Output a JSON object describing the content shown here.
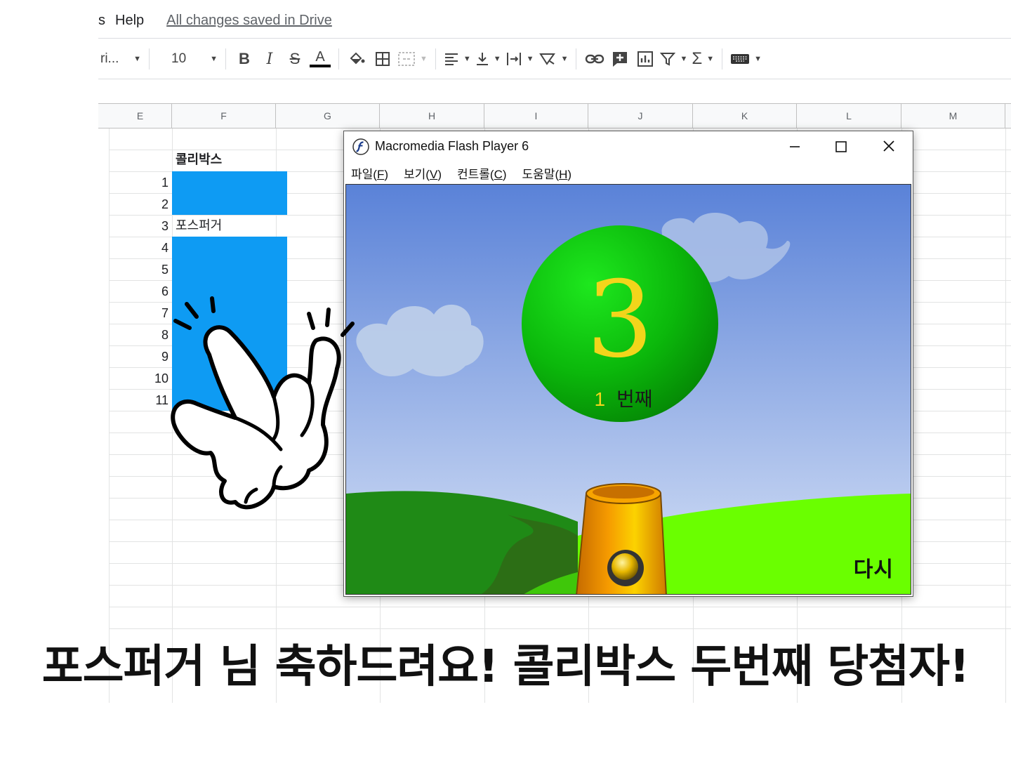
{
  "menubar": {
    "items": [
      "s",
      "Help"
    ],
    "saved_status": "All changes saved in Drive"
  },
  "toolbar": {
    "font_name": "ri...",
    "font_size": "10",
    "bold": "B",
    "italic": "I",
    "strike": "S",
    "text_color": "A",
    "sum": "Σ"
  },
  "sheet": {
    "columns": [
      "E",
      "F",
      "G",
      "H",
      "I",
      "J",
      "K",
      "L",
      "M"
    ],
    "header_cell": "콜리박스",
    "rows": [
      "1",
      "2",
      "3",
      "4",
      "5",
      "6",
      "7",
      "8",
      "9",
      "10",
      "11"
    ],
    "winner_cell": "포스퍼거",
    "highlight_color": "#0e9bf3"
  },
  "flash_window": {
    "title": "Macromedia Flash Player 6",
    "menu": [
      {
        "label": "파일(",
        "key": "F",
        "end": ")"
      },
      {
        "label": "보기(",
        "key": "V",
        "end": ")"
      },
      {
        "label": "컨트롤(",
        "key": "C",
        "end": ")"
      },
      {
        "label": "도움말(",
        "key": "H",
        "end": ")"
      }
    ],
    "ball_number": "3",
    "ball_count": "1",
    "ball_suffix": "번째",
    "replay_label": "다시"
  },
  "caption": "포스퍼거 님 축하드려요! 콜리박스 두번째 당첨자!"
}
